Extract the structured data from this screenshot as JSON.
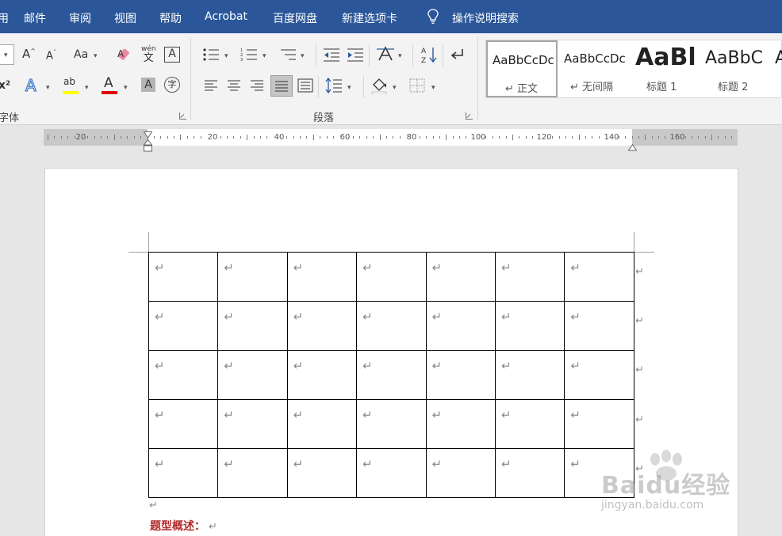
{
  "menubar": {
    "tabs": [
      "邮件",
      "审阅",
      "视图",
      "帮助",
      "Acrobat",
      "百度网盘",
      "新建选项卡"
    ],
    "left_fragment": "用",
    "search_label": "操作说明搜索"
  },
  "ribbon": {
    "font_group_label": "字体",
    "paragraph_group_label": "段落",
    "font_icons": {
      "grow_font": "A",
      "shrink_font": "A",
      "change_case": "Aa",
      "phonetic_top": "wén",
      "phonetic_bottom": "文",
      "char_border": "A",
      "superscript": "x²",
      "text_effect": "A",
      "highlight": "ab",
      "font_color": "A",
      "char_shading": "A",
      "enclose_char": "字"
    },
    "highlight_color": "#ffff00",
    "font_color_bar": "#e00000",
    "styles": [
      {
        "sample": "AaBbCcDc",
        "name": "↵ 正文",
        "selected": true
      },
      {
        "sample": "AaBbCcDc",
        "name": "↵ 无间隔",
        "selected": false
      },
      {
        "sample": "AaBl",
        "name": "标题 1",
        "selected": false
      },
      {
        "sample": "AaBbC",
        "name": "标题 2",
        "selected": false
      },
      {
        "sample": "A",
        "name": "",
        "selected": false
      }
    ]
  },
  "ruler": {
    "labels": [
      "20",
      "20",
      "40",
      "60",
      "80",
      "100",
      "120",
      "140",
      "160"
    ]
  },
  "document": {
    "table": {
      "rows": 5,
      "cols": 7,
      "cell_mark": "↵"
    },
    "row_end_mark": "↵",
    "after_table_mark": "↵",
    "heading_text": "题型概述：",
    "heading_mark": "↵"
  },
  "watermark": {
    "brand": "Baidu经验",
    "url": "jingyan.baidu.com"
  }
}
